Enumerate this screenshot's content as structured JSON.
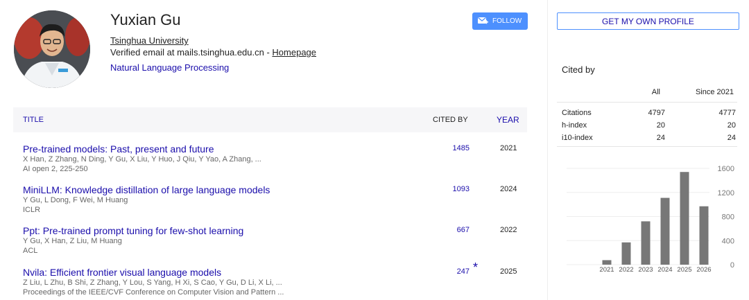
{
  "profile": {
    "name": "Yuxian Gu",
    "affiliation": "Tsinghua University",
    "email_text": "Verified email at mails.tsinghua.edu.cn - ",
    "homepage": "Homepage",
    "interest": "Natural Language Processing",
    "follow_label": "FOLLOW"
  },
  "table": {
    "header": {
      "title": "TITLE",
      "cited_by": "CITED BY",
      "year": "YEAR"
    },
    "rows": [
      {
        "title": "Pre-trained models: Past, present and future",
        "authors": "X Han, Z Zhang, N Ding, Y Gu, X Liu, Y Huo, J Qiu, Y Yao, A Zhang, ...",
        "venue": "AI open 2, 225-250",
        "cited": "1485",
        "star": "",
        "year": "2021"
      },
      {
        "title": "MiniLLM: Knowledge distillation of large language models",
        "authors": "Y Gu, L Dong, F Wei, M Huang",
        "venue": "ICLR",
        "cited": "1093",
        "star": "",
        "year": "2024"
      },
      {
        "title": "Ppt: Pre-trained prompt tuning for few-shot learning",
        "authors": "Y Gu, X Han, Z Liu, M Huang",
        "venue": "ACL",
        "cited": "667",
        "star": "",
        "year": "2022"
      },
      {
        "title": "Nvila: Efficient frontier visual language models",
        "authors": "Z Liu, L Zhu, B Shi, Z Zhang, Y Lou, S Yang, H Xi, S Cao, Y Gu, D Li, X Li, ...",
        "venue": "Proceedings of the IEEE/CVF Conference on Computer Vision and Pattern ...",
        "cited": "247",
        "star": "*",
        "year": "2025"
      }
    ]
  },
  "sidebar": {
    "get_profile_label": "GET MY OWN PROFILE",
    "cited_by_title": "Cited by",
    "col_all": "All",
    "col_since": "Since 2021",
    "metrics": [
      {
        "label": "Citations",
        "all": "4797",
        "since": "4777"
      },
      {
        "label": "h-index",
        "all": "20",
        "since": "20"
      },
      {
        "label": "i10-index",
        "all": "24",
        "since": "24"
      }
    ]
  },
  "chart_data": {
    "type": "bar",
    "categories": [
      "2021",
      "2022",
      "2023",
      "2024",
      "2025",
      "2026"
    ],
    "values": [
      75,
      370,
      720,
      1110,
      1540,
      970
    ],
    "yticks": [
      0,
      400,
      800,
      1200,
      1600
    ],
    "ylim": [
      0,
      1600
    ],
    "bar_color": "#777777"
  },
  "colors": {
    "link": "#1a0dab",
    "accent": "#4d90fe"
  }
}
